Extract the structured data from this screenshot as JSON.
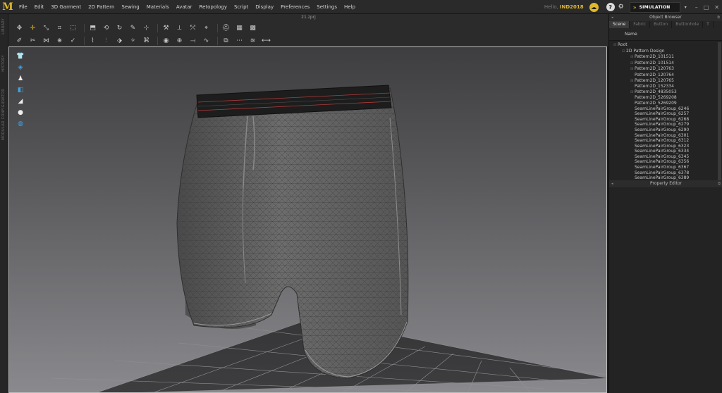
{
  "app": {
    "logo_text": "M",
    "build_prefix": "Hello,",
    "build_label": "IND2018",
    "file_title": "21.zprj"
  },
  "menu": [
    "File",
    "Edit",
    "3D Garment",
    "2D Pattern",
    "Sewing",
    "Materials",
    "Avatar",
    "Retopology",
    "Script",
    "Display",
    "Preferences",
    "Settings",
    "Help"
  ],
  "header_right": {
    "help_glyph": "?",
    "mode_label": "SIMULATION",
    "dropdown_glyph": "▾",
    "window_controls": [
      "–",
      "□",
      "✕"
    ]
  },
  "left_strip_labels": [
    "LIBRARY",
    "HISTORY",
    "MODULAR CONFIGURATOR"
  ],
  "object_browser": {
    "title": "Object Browser",
    "tabs": [
      "Scene",
      "Fabric",
      "Button",
      "Buttonhole",
      "T"
    ],
    "column_header": "Name",
    "tree": [
      {
        "label": "Root",
        "level": 0,
        "expander": "⊟"
      },
      {
        "label": "2D Pattern Design",
        "level": 1,
        "expander": "⊟"
      },
      {
        "label": "Pattern2D_101511",
        "level": 2,
        "expander": "⊞"
      },
      {
        "label": "Pattern2D_101514",
        "level": 2,
        "expander": "⊞"
      },
      {
        "label": "Pattern2D_120763",
        "level": 2,
        "expander": "⊞"
      },
      {
        "label": "Pattern2D_120764",
        "level": 2,
        "expander": ""
      },
      {
        "label": "Pattern2D_120765",
        "level": 2,
        "expander": "⊞"
      },
      {
        "label": "Pattern2D_152334",
        "level": 2,
        "expander": ""
      },
      {
        "label": "Pattern2D_4835053",
        "level": 2,
        "expander": "⊞"
      },
      {
        "label": "Pattern2D_5269208",
        "level": 2,
        "expander": ""
      },
      {
        "label": "Pattern2D_5269209",
        "level": 2,
        "expander": ""
      },
      {
        "label": "SeamLinePairGroup_6246",
        "level": 2,
        "expander": ""
      },
      {
        "label": "SeamLinePairGroup_6257",
        "level": 2,
        "expander": ""
      },
      {
        "label": "SeamLinePairGroup_6268",
        "level": 2,
        "expander": ""
      },
      {
        "label": "SeamLinePairGroup_6279",
        "level": 2,
        "expander": ""
      },
      {
        "label": "SeamLinePairGroup_6290",
        "level": 2,
        "expander": ""
      },
      {
        "label": "SeamLinePairGroup_6301",
        "level": 2,
        "expander": ""
      },
      {
        "label": "SeamLinePairGroup_6312",
        "level": 2,
        "expander": ""
      },
      {
        "label": "SeamLinePairGroup_6323",
        "level": 2,
        "expander": ""
      },
      {
        "label": "SeamLinePairGroup_6334",
        "level": 2,
        "expander": ""
      },
      {
        "label": "SeamLinePairGroup_6345",
        "level": 2,
        "expander": ""
      },
      {
        "label": "SeamLinePairGroup_6356",
        "level": 2,
        "expander": ""
      },
      {
        "label": "SeamLinePairGroup_6367",
        "level": 2,
        "expander": ""
      },
      {
        "label": "SeamLinePairGroup_6378",
        "level": 2,
        "expander": ""
      },
      {
        "label": "SeamLinePairGroup_6389",
        "level": 2,
        "expander": ""
      }
    ]
  },
  "property_editor": {
    "title": "Property Editor"
  },
  "toolbar_row1": [
    {
      "name": "select-move-icon",
      "glyph": "✥",
      "active": false
    },
    {
      "name": "transform-pattern-icon",
      "glyph": "✛",
      "active": true
    },
    {
      "name": "edit-pattern-icon",
      "glyph": "⤡",
      "active": false
    },
    {
      "name": "edit-curve-icon",
      "glyph": "⌗",
      "active": false
    },
    {
      "name": "edit-point-icon",
      "glyph": "⬚",
      "active": false
    },
    {
      "name": "fold-arrangement-icon",
      "glyph": "⬒",
      "active": false
    },
    {
      "name": "gizmo-icon",
      "glyph": "⟲",
      "active": false
    },
    {
      "name": "rotate-icon",
      "glyph": "↻",
      "active": false
    },
    {
      "name": "pin-icon",
      "glyph": "✎",
      "active": false
    },
    {
      "name": "tack-icon",
      "glyph": "⊹",
      "active": false
    },
    {
      "name": "brush-icon",
      "glyph": "⚒",
      "active": false
    },
    {
      "name": "strengthen-icon",
      "glyph": "⟂",
      "active": false
    },
    {
      "name": "reset-icon",
      "glyph": "⤲",
      "active": false
    },
    {
      "name": "measure-icon",
      "glyph": "⌖",
      "active": false
    },
    {
      "name": "avatar-display-icon",
      "glyph": "⛑",
      "active": false
    },
    {
      "name": "texture-display-icon",
      "glyph": "▦",
      "active": false
    },
    {
      "name": "mesh-display-icon",
      "glyph": "▩",
      "active": false
    }
  ],
  "toolbar_row2": [
    {
      "name": "select-mesh-icon",
      "glyph": "✐",
      "active": false
    },
    {
      "name": "sewing-icon",
      "glyph": "✂",
      "active": false
    },
    {
      "name": "segment-sewing-icon",
      "glyph": "⋈",
      "active": false
    },
    {
      "name": "free-sewing-icon",
      "glyph": "⋇",
      "active": false
    },
    {
      "name": "check-sewing-icon",
      "glyph": "✓",
      "active": false
    },
    {
      "name": "fold-icon",
      "glyph": "⌇",
      "active": false
    },
    {
      "name": "pleat-icon",
      "glyph": "⫶",
      "active": false
    },
    {
      "name": "texture-transform-icon",
      "glyph": "⬗",
      "active": false
    },
    {
      "name": "graphic-icon",
      "glyph": "✧",
      "active": false
    },
    {
      "name": "grid-icon",
      "glyph": "⌘",
      "active": false
    },
    {
      "name": "button-icon",
      "glyph": "◉",
      "active": false
    },
    {
      "name": "buttonhole-icon",
      "glyph": "⊕",
      "active": false
    },
    {
      "name": "zipper-icon",
      "glyph": "⟞",
      "active": false
    },
    {
      "name": "piping-icon",
      "glyph": "∿",
      "active": false
    },
    {
      "name": "topstitch-icon",
      "glyph": "⧉",
      "active": false
    },
    {
      "name": "seamline-icon",
      "glyph": "⋯",
      "active": false
    },
    {
      "name": "puckering-icon",
      "glyph": "≋",
      "active": false
    },
    {
      "name": "measure-length-icon",
      "glyph": "⟷",
      "active": false
    }
  ],
  "viewport_tools": [
    {
      "name": "garment-display-icon",
      "glyph": "👕",
      "blue": false
    },
    {
      "name": "texture-mode-icon",
      "glyph": "◈",
      "blue": true
    },
    {
      "name": "avatar-mode-icon",
      "glyph": "♟",
      "blue": false
    },
    {
      "name": "shaded-mode-icon",
      "glyph": "◧",
      "blue": true
    },
    {
      "name": "pattern-mode-icon",
      "glyph": "◢",
      "blue": false
    },
    {
      "name": "skin-mode-icon",
      "glyph": "●",
      "blue": false
    },
    {
      "name": "environment-icon",
      "glyph": "◍",
      "blue": true
    }
  ]
}
